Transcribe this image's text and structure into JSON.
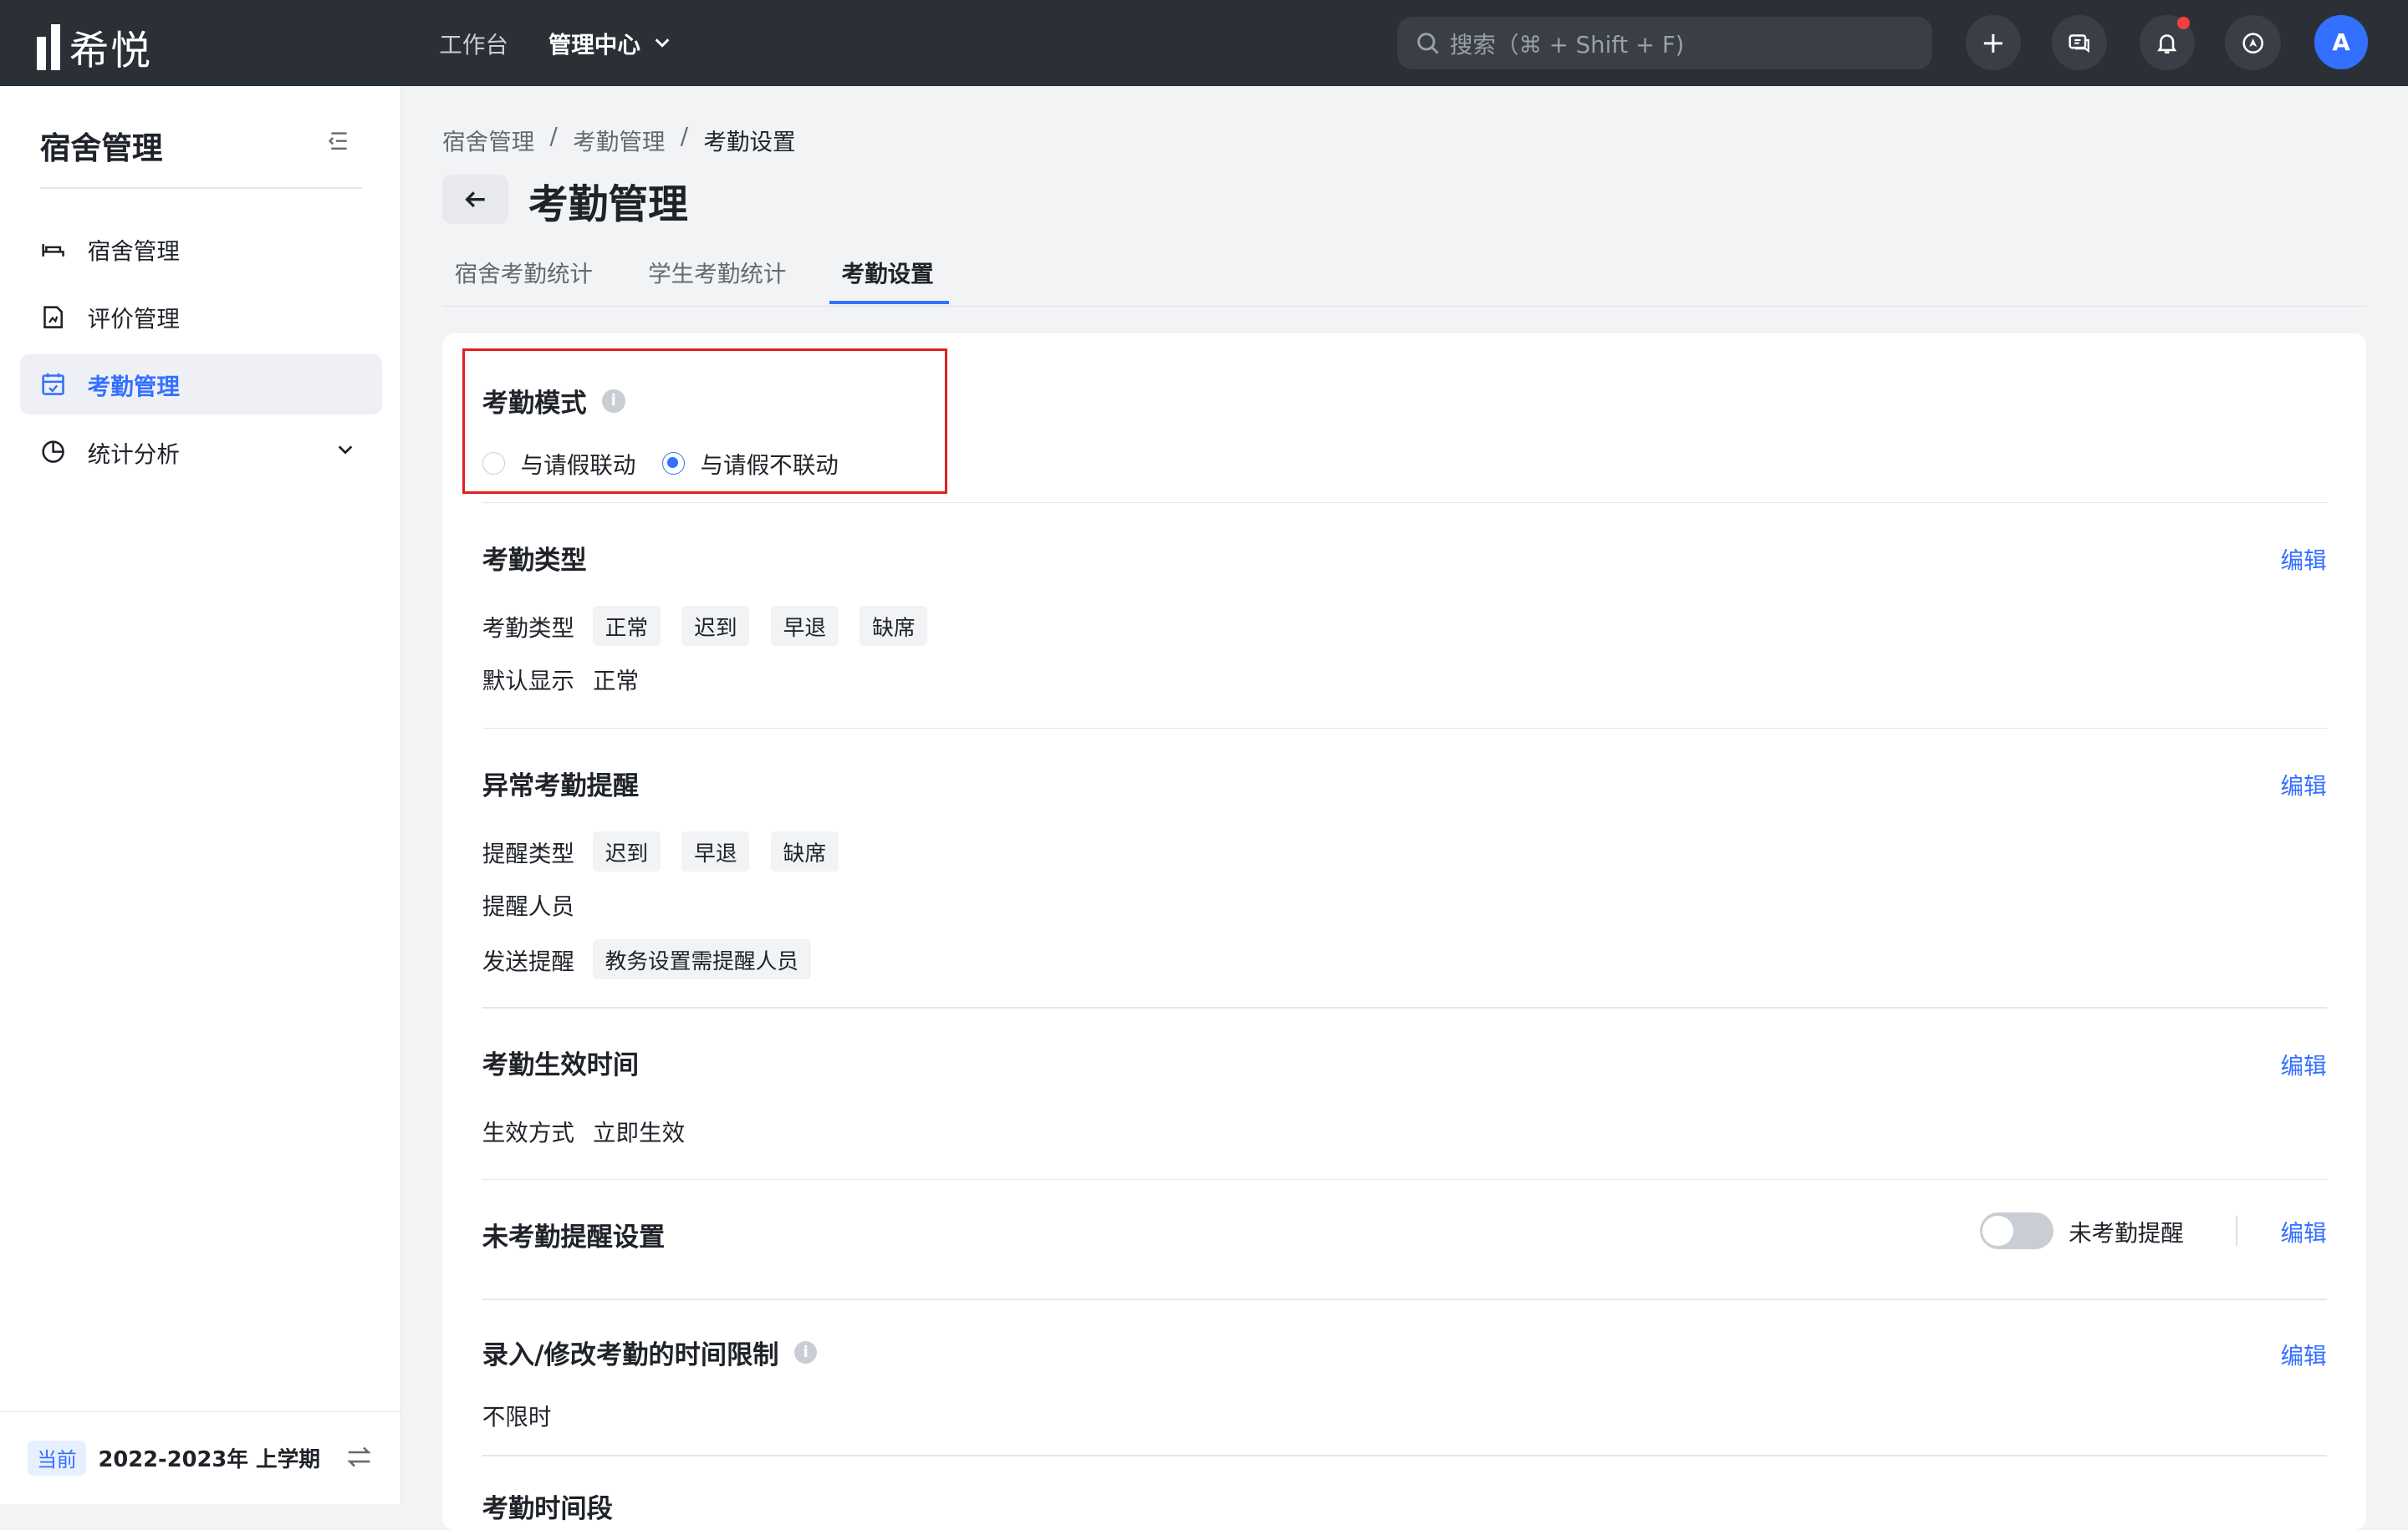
{
  "app": {
    "logo_text": "希悦"
  },
  "topnav": {
    "workbench": "工作台",
    "admin_center": "管理中心"
  },
  "search": {
    "placeholder": "搜索（⌘ + Shift + F)"
  },
  "user": {
    "avatar_letter": "A"
  },
  "sidebar": {
    "title": "宿舍管理",
    "items": [
      {
        "label": "宿舍管理",
        "icon": "bed-icon"
      },
      {
        "label": "评价管理",
        "icon": "document-chart-icon"
      },
      {
        "label": "考勤管理",
        "icon": "calendar-check-icon",
        "active": true
      },
      {
        "label": "统计分析",
        "icon": "pie-chart-icon"
      }
    ],
    "footer": {
      "badge": "当前",
      "term": "2022-2023年 上学期"
    }
  },
  "breadcrumb": [
    "宿舍管理",
    "考勤管理",
    "考勤设置"
  ],
  "breadcrumb_sep": "/",
  "page": {
    "title": "考勤管理"
  },
  "tabs": [
    "宿舍考勤统计",
    "学生考勤统计",
    "考勤设置"
  ],
  "edit_label": "编辑",
  "mode": {
    "title": "考勤模式",
    "options": [
      "与请假联动",
      "与请假不联动"
    ],
    "selected_index": 1
  },
  "types": {
    "title": "考勤类型",
    "label": "考勤类型",
    "tags": [
      "正常",
      "迟到",
      "早退",
      "缺席"
    ],
    "default_label": "默认显示",
    "default_value": "正常"
  },
  "alert": {
    "title": "异常考勤提醒",
    "type_label": "提醒类型",
    "type_tags": [
      "迟到",
      "早退",
      "缺席"
    ],
    "people_label": "提醒人员",
    "send_label": "发送提醒",
    "send_tag": "教务设置需提醒人员"
  },
  "effective": {
    "title": "考勤生效时间",
    "label": "生效方式",
    "value": "立即生效"
  },
  "unchecked": {
    "title": "未考勤提醒设置",
    "toggle_label": "未考勤提醒",
    "toggle_on": false
  },
  "limit": {
    "title": "录入/修改考勤的时间限制",
    "value": "不限时"
  },
  "period": {
    "title": "考勤时间段"
  }
}
